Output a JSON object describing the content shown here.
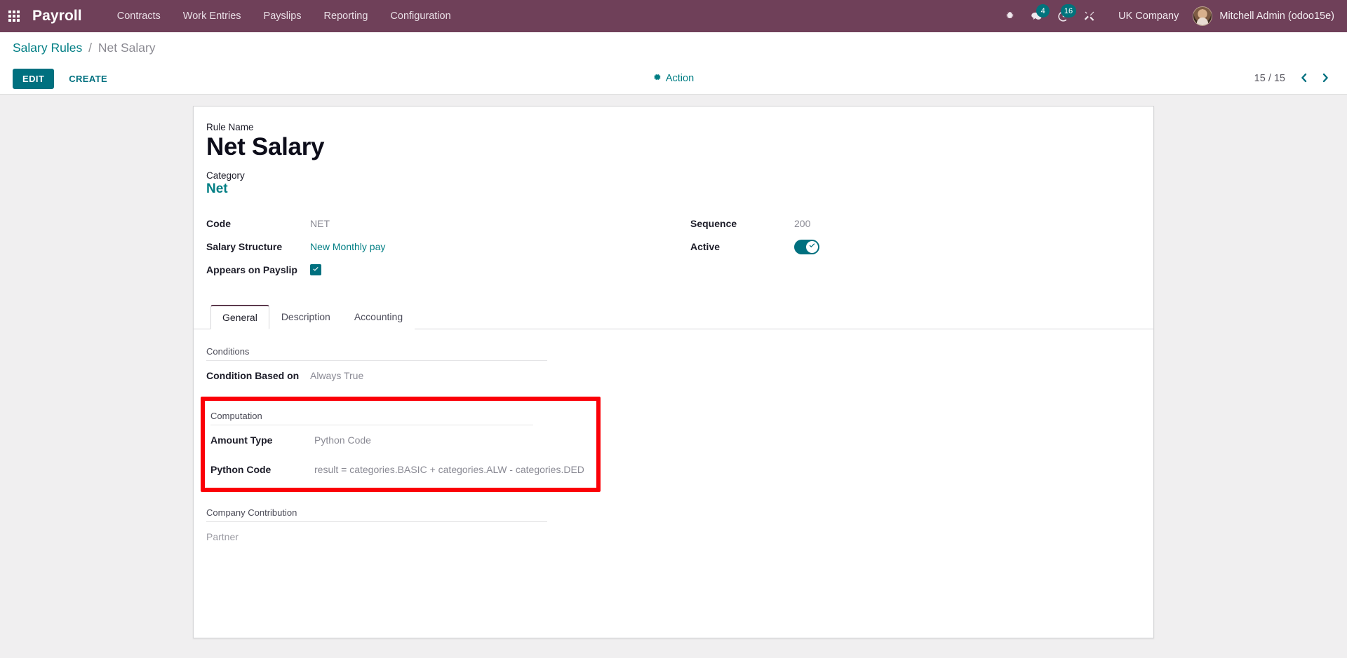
{
  "navbar": {
    "apps_icon": "apps-grid-icon",
    "brand": "Payroll",
    "menu": [
      {
        "label": "Contracts"
      },
      {
        "label": "Work Entries"
      },
      {
        "label": "Payslips"
      },
      {
        "label": "Reporting"
      },
      {
        "label": "Configuration"
      }
    ],
    "icons": {
      "debug": "bug-icon",
      "messages": "chat-bubble-icon",
      "messages_count": "4",
      "activities": "clock-activity-icon",
      "activities_count": "16",
      "tools": "tools-icon"
    },
    "company": "UK Company",
    "user": "Mitchell Admin (odoo15e)"
  },
  "control_panel": {
    "breadcrumb_root": "Salary Rules",
    "breadcrumb_sep": "/",
    "breadcrumb_current": "Net Salary",
    "edit_label": "EDIT",
    "create_label": "CREATE",
    "action_label": "Action",
    "pager_count": "15 / 15"
  },
  "form": {
    "rule_name_label": "Rule Name",
    "rule_name_value": "Net Salary",
    "category_label": "Category",
    "category_value": "Net",
    "left_fields": [
      {
        "label": "Code",
        "value": "NET",
        "type": "text"
      },
      {
        "label": "Salary Structure",
        "value": "New Monthly pay",
        "type": "link"
      },
      {
        "label": "Appears on Payslip",
        "value": "",
        "type": "checkbox"
      }
    ],
    "right_fields": [
      {
        "label": "Sequence",
        "value": "200",
        "type": "text"
      },
      {
        "label": "Active",
        "value": "",
        "type": "toggle"
      }
    ],
    "tabs": [
      {
        "label": "General",
        "active": true
      },
      {
        "label": "Description",
        "active": false
      },
      {
        "label": "Accounting",
        "active": false
      }
    ],
    "general_tab": {
      "conditions": {
        "title": "Conditions",
        "condition_based_label": "Condition Based on",
        "condition_based_value": "Always True"
      },
      "computation": {
        "title": "Computation",
        "amount_type_label": "Amount Type",
        "amount_type_value": "Python Code",
        "python_code_label": "Python Code",
        "python_code_value": "result = categories.BASIC + categories.ALW - categories.DED"
      },
      "company_contribution": {
        "title": "Company Contribution",
        "partner_label": "Partner"
      }
    }
  },
  "colors": {
    "navbar_bg": "#6f4059",
    "accent_teal": "#00707f",
    "highlight_red": "#fb0007",
    "page_bg": "#f0eff0"
  }
}
